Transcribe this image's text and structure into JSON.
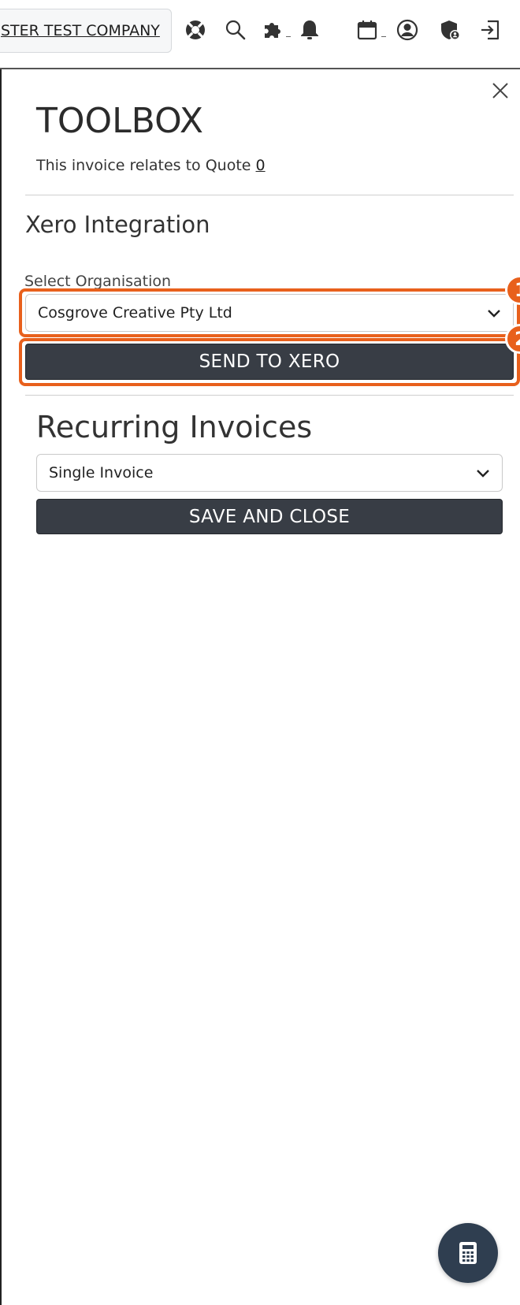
{
  "header": {
    "company_name": "STER TEST COMPANY",
    "icons": [
      "lifebuoy-icon",
      "search-icon",
      "puzzle-icon",
      "bell-icon",
      "calendar-icon",
      "user-circle-icon",
      "shield-user-icon",
      "logout-icon"
    ]
  },
  "toolbox": {
    "title": "TOOLBOX",
    "quote_text": "This invoice relates to Quote",
    "quote_number": "0"
  },
  "xero": {
    "section_title": "Xero Integration",
    "org_label": "Select Organisation",
    "org_selected": "Cosgrove Creative Pty Ltd",
    "send_button": "SEND TO XERO",
    "badges": [
      "1",
      "2"
    ],
    "highlight_color": "#e8601c"
  },
  "recurring": {
    "section_title": "Recurring Invoices",
    "selected": "Single Invoice",
    "save_button": "SAVE AND CLOSE"
  },
  "fab": {
    "icon": "calculator-icon"
  }
}
